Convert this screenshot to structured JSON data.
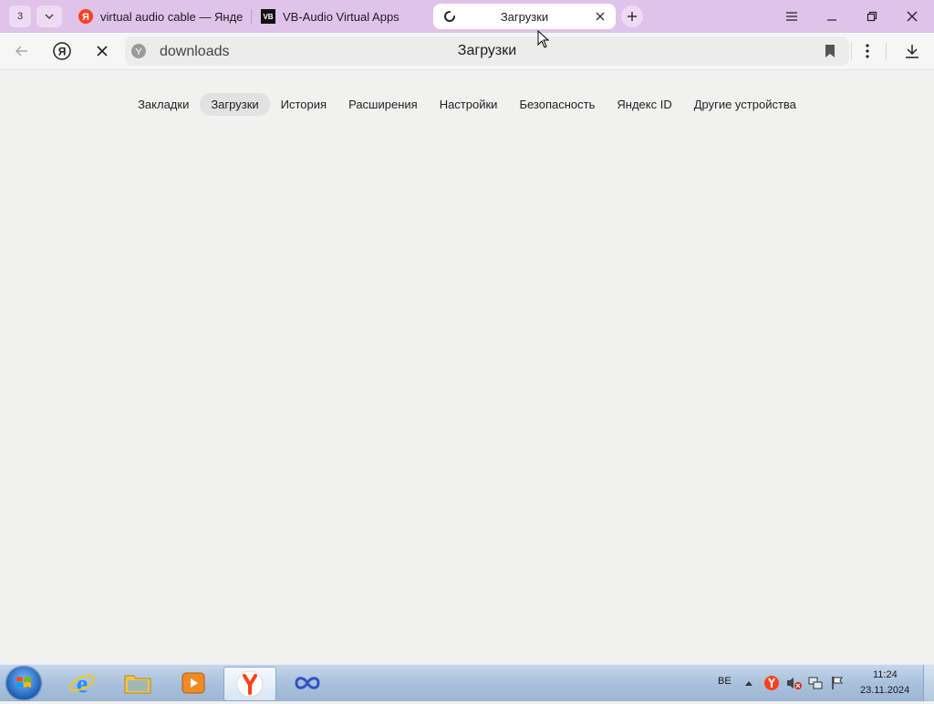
{
  "browser": {
    "tab_counter": "3",
    "tabs": [
      {
        "title": "virtual audio cable — Яндекс",
        "favicon": "yandex-icon"
      },
      {
        "title": "VB-Audio Virtual Apps",
        "favicon": "vb-audio-icon"
      },
      {
        "title": "Загрузки",
        "favicon": "loading-spinner-icon",
        "active": true
      }
    ],
    "address": {
      "value": "downloads",
      "page_title": "Загрузки"
    }
  },
  "settings_nav": {
    "items": [
      {
        "label": "Закладки"
      },
      {
        "label": "Загрузки",
        "active": true
      },
      {
        "label": "История"
      },
      {
        "label": "Расширения"
      },
      {
        "label": "Настройки"
      },
      {
        "label": "Безопасность"
      },
      {
        "label": "Яндекс ID"
      },
      {
        "label": "Другие устройства"
      }
    ]
  },
  "taskbar": {
    "language": "BE",
    "clock": {
      "time": "11:24",
      "date": "23.11.2024"
    }
  },
  "colors": {
    "tabstrip": "#dfc3e9",
    "page_background": "#f1f1f0",
    "yandex_red": "#fc3f1d"
  }
}
